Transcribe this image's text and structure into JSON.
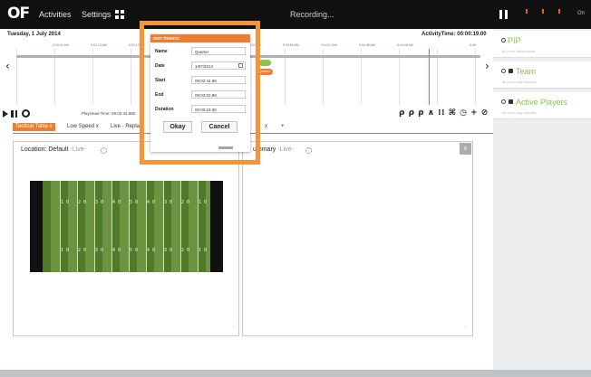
{
  "topbar": {
    "logo": "OF",
    "nav": [
      "Activities",
      "Settings"
    ],
    "recording": "Recording...",
    "right_text": "On"
  },
  "sidebar": {
    "panels": [
      {
        "title": "PIP",
        "sub": "all  none  follow/range",
        "locked": false
      },
      {
        "title": "Team",
        "sub": "all  none  play  injected",
        "locked": true
      },
      {
        "title": "Active Players",
        "sub": "all  none  play  injected",
        "locked": true
      }
    ]
  },
  "timeline": {
    "date": "Tuesday, 1 July 2014",
    "activity_time": "ActivityTime: 00:00:19.00",
    "ticks": [
      "9:03:34 AM",
      "9:03:13 AM",
      "9:03:13 AM",
      "9:03:34 AM",
      "9:03:55 AM",
      "9:04:17 AM",
      "9:04:38 AM",
      "9:04:48 AM",
      "9:05:"
    ],
    "pill_label": "Quarter"
  },
  "controls": {
    "playhead": "PlayHead Time: 09:02:44.880",
    "tools": "ρ ρ ρ ∧ ⁞⁞ ⌘ ◷ + ⊘"
  },
  "tabs": [
    {
      "label": "Tactical Table  x",
      "active": true
    },
    {
      "label": "Low Speed  x",
      "active": false
    },
    {
      "label": "Live - Repla",
      "active": false
    },
    {
      "label": "x",
      "active": false
    },
    {
      "label": "+",
      "active": false
    }
  ],
  "panels": {
    "left": {
      "title": "Location: Default",
      "live": " -Live-"
    },
    "right": {
      "title": "ummary",
      "live": " -Live-",
      "close": "x"
    }
  },
  "field": {
    "numbers": [
      "1 0",
      "2 0",
      "3 0",
      "4 0",
      "5 0",
      "4 0",
      "3 0",
      "2 0",
      "1 0"
    ]
  },
  "dialog": {
    "title": "EDIT PERIOD",
    "name_label": "Name",
    "name_value": "Quarter",
    "date_label": "Date",
    "date_value": "1/07/2014",
    "start_label": "Start",
    "start_value": "09:02:44.88",
    "end_label": "End",
    "end_value": "09:03:03.88",
    "duration_label": "Duration",
    "duration_value": "00:00:19.00",
    "okay": "Okay",
    "cancel": "Cancel"
  },
  "colors": {
    "accent_orange": "#ed7d31",
    "frame_orange": "#f29637",
    "sidebar_green": "#8bc34a",
    "topbar": "#101010"
  }
}
